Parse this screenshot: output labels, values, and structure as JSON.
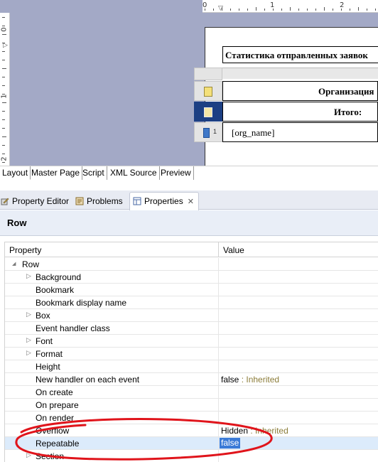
{
  "ruler": {
    "top_numbers": [
      "0",
      "1",
      "2"
    ],
    "left_numbers": [
      "0",
      "1",
      "2"
    ]
  },
  "report": {
    "title": "Статистика отправленных заявок",
    "header_cell": "Организация",
    "total_cell": "Итого:",
    "detail_cell": "[org_name]",
    "row_handle_number": "1"
  },
  "editor_tabs": [
    "Layout",
    "Master Page",
    "Script",
    "XML Source",
    "Preview"
  ],
  "view_tabs": [
    {
      "label": "Property Editor",
      "icon": "property-editor-icon"
    },
    {
      "label": "Problems",
      "icon": "problems-icon"
    },
    {
      "label": "Properties",
      "icon": "properties-icon",
      "close": "✕"
    }
  ],
  "panel": {
    "title": "Row"
  },
  "grid": {
    "col_property": "Property",
    "col_value": "Value",
    "inherited_label": "Inherited",
    "group": "Row",
    "rows": [
      {
        "name": "Background",
        "value": "",
        "inherited": false,
        "expandable": true
      },
      {
        "name": "Bookmark",
        "value": "",
        "inherited": false,
        "expandable": false
      },
      {
        "name": "Bookmark display name",
        "value": "",
        "inherited": false,
        "expandable": false
      },
      {
        "name": "Box",
        "value": "",
        "inherited": false,
        "expandable": true
      },
      {
        "name": "Event handler class",
        "value": "",
        "inherited": false,
        "expandable": false
      },
      {
        "name": "Font",
        "value": "",
        "inherited": false,
        "expandable": true
      },
      {
        "name": "Format",
        "value": "",
        "inherited": false,
        "expandable": true
      },
      {
        "name": "Height",
        "value": "",
        "inherited": false,
        "expandable": false
      },
      {
        "name": "New handler on each event",
        "value": "false",
        "inherited": true,
        "expandable": false
      },
      {
        "name": "On create",
        "value": "",
        "inherited": false,
        "expandable": false
      },
      {
        "name": "On prepare",
        "value": "",
        "inherited": false,
        "expandable": false
      },
      {
        "name": "On render",
        "value": "",
        "inherited": false,
        "expandable": false
      },
      {
        "name": "Overflow",
        "value": "Hidden",
        "inherited": true,
        "expandable": false
      },
      {
        "name": "Repeatable",
        "value": "false",
        "inherited": false,
        "expandable": false,
        "selected": true
      },
      {
        "name": "Section",
        "value": "",
        "inherited": false,
        "expandable": true
      }
    ]
  },
  "colors": {
    "editor_background": "#a3a9c6",
    "selected_row_handle": "#1c3f83",
    "selection_blue": "#3a7ad7",
    "inherited_text": "#8c7d3a",
    "annotation_red": "#e0141b"
  }
}
